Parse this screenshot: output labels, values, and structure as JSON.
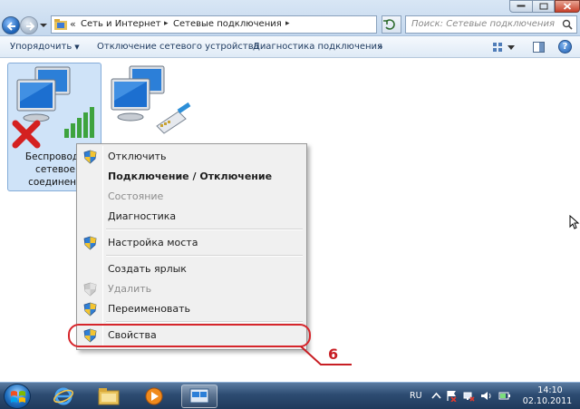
{
  "addressbar": {
    "overflow": "«",
    "breadcrumbs": [
      "Сеть и Интернет",
      "Сетевые подключения"
    ],
    "search_placeholder": "Поиск: Сетевые подключения"
  },
  "commandbar": {
    "organize": "Упорядочить",
    "disable_device": "Отключение сетевого устройства",
    "diagnose": "Диагностика подключения",
    "more": "»"
  },
  "connections": [
    {
      "label": "Беспроводн\nсетевое\nсоединени",
      "status": "disconnected",
      "selected": true
    },
    {
      "label": "",
      "status": "lan",
      "selected": false
    }
  ],
  "context_menu": {
    "items": [
      {
        "label": "Отключить",
        "shield": true,
        "bold": false,
        "disabled": false
      },
      {
        "label": "Подключение / Отключение",
        "shield": false,
        "bold": true,
        "disabled": false
      },
      {
        "label": "Состояние",
        "shield": false,
        "bold": false,
        "disabled": true
      },
      {
        "label": "Диагностика",
        "shield": false,
        "bold": false,
        "disabled": false
      },
      {
        "label": "Настройка моста",
        "shield": true,
        "bold": false,
        "disabled": false
      },
      {
        "label": "Создать ярлык",
        "shield": false,
        "bold": false,
        "disabled": false
      },
      {
        "label": "Удалить",
        "shield": true,
        "bold": false,
        "disabled": true
      },
      {
        "label": "Переименовать",
        "shield": true,
        "bold": false,
        "disabled": false
      },
      {
        "label": "Свойства",
        "shield": true,
        "bold": false,
        "disabled": false
      }
    ]
  },
  "annotation": {
    "number": "6",
    "color": "#d6252b"
  },
  "taskbar": {
    "language": "RU",
    "time": "14:10",
    "date": "02.10.2011"
  },
  "colors": {
    "selection": "#cfe3f8",
    "menu_bg": "#f0f0f0",
    "taskbar": "#2d4c72"
  }
}
